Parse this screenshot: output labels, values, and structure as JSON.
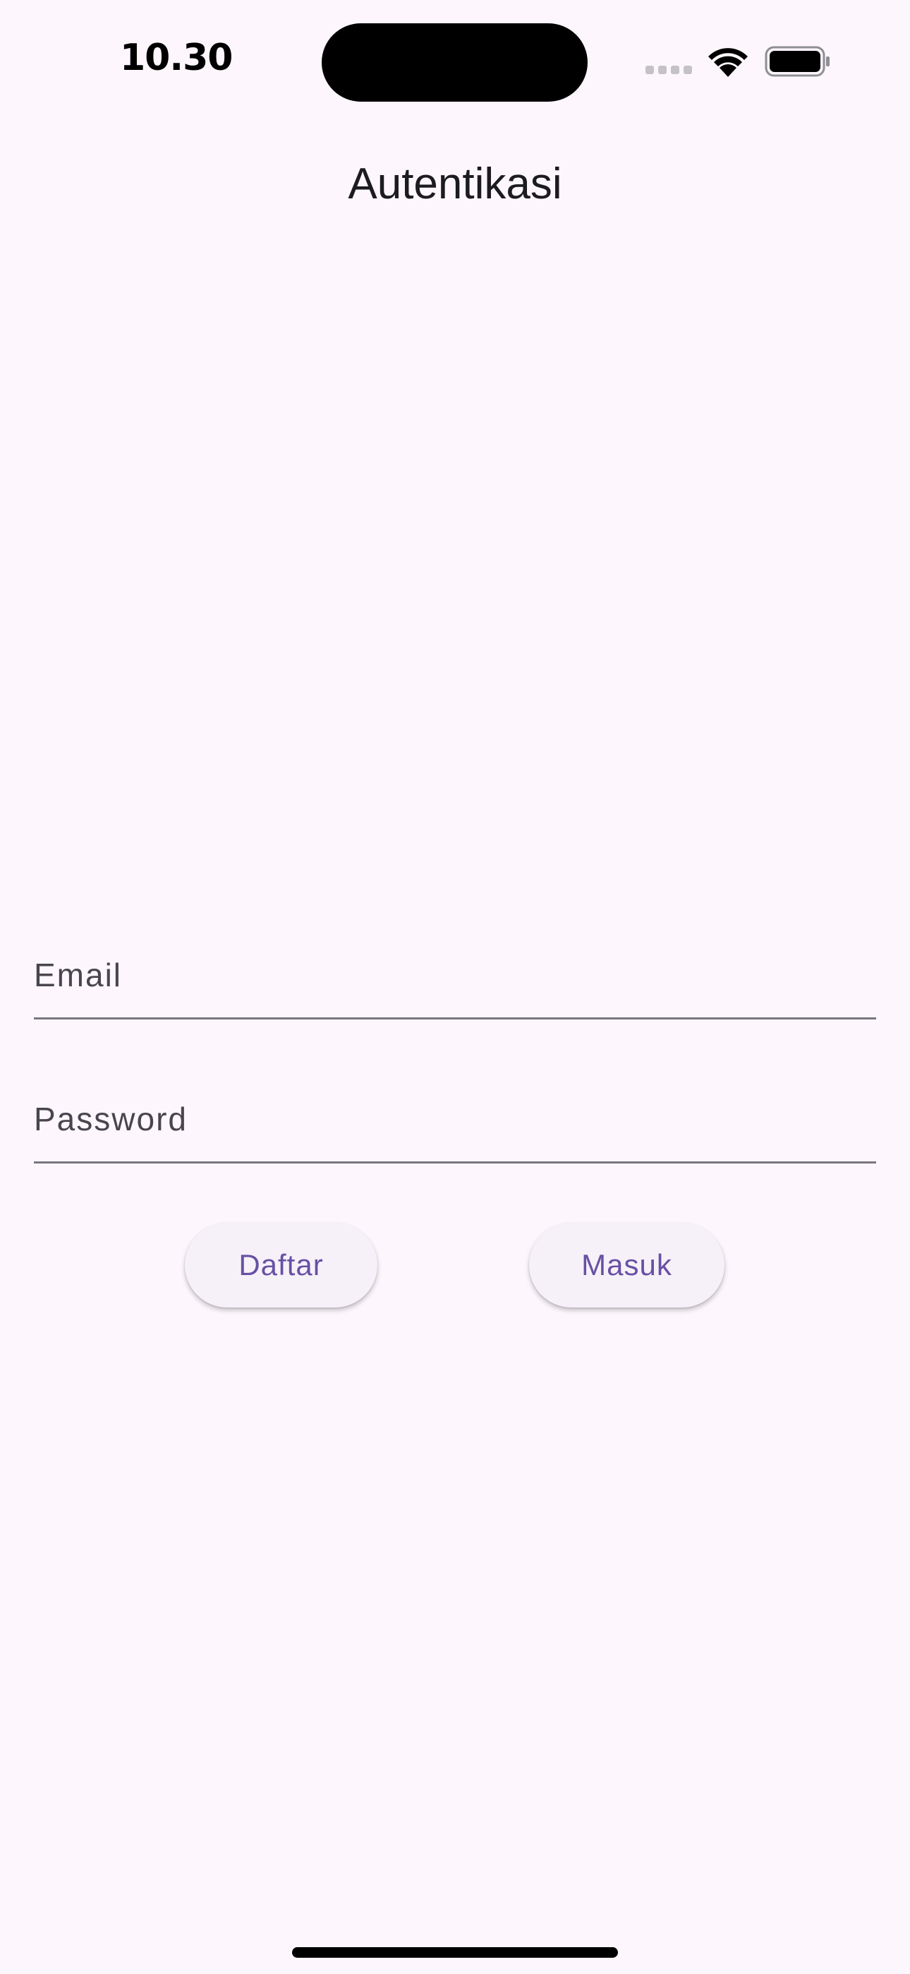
{
  "status_bar": {
    "time": "10.30",
    "icons": [
      "cellular-signal-icon",
      "wifi-icon",
      "battery-icon"
    ]
  },
  "app_bar": {
    "title": "Autentikasi"
  },
  "form": {
    "email": {
      "placeholder": "Email",
      "value": ""
    },
    "password": {
      "placeholder": "Password",
      "value": ""
    }
  },
  "actions": {
    "register_label": "Daftar",
    "login_label": "Masuk"
  },
  "colors": {
    "background": "#fdf7fd",
    "accent": "#6750a4",
    "button_surface": "#f6f1f8",
    "underline": "#7a7580"
  }
}
